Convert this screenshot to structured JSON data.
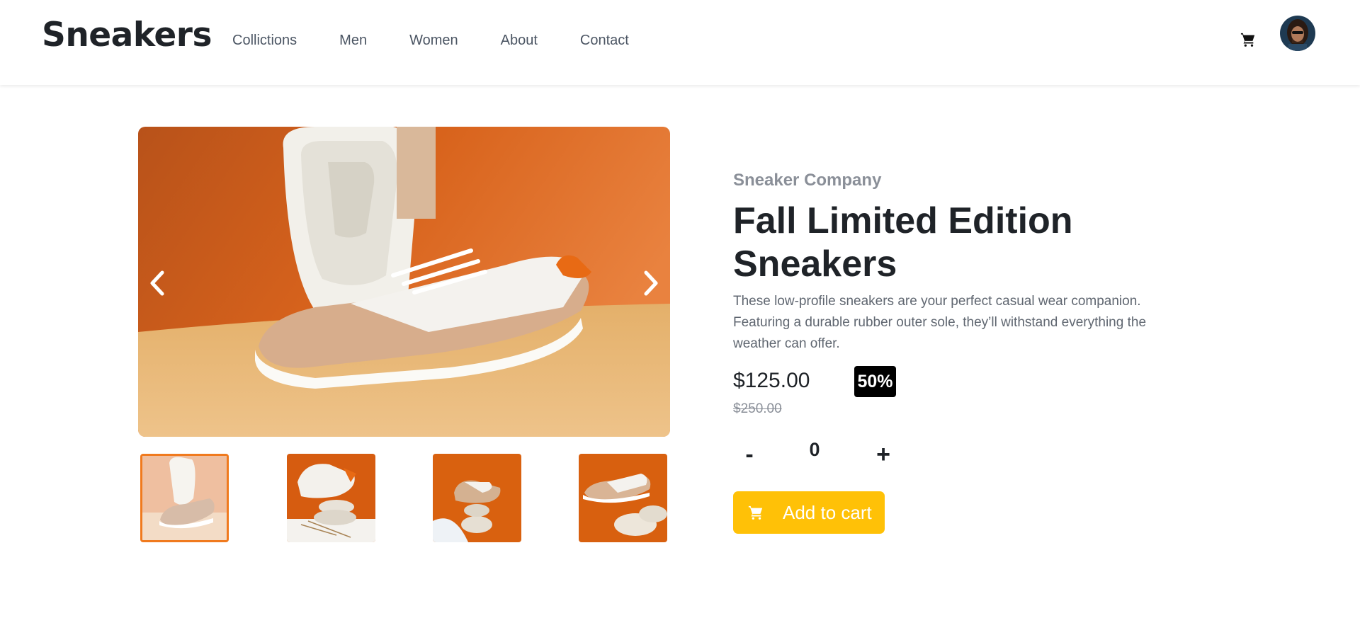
{
  "header": {
    "logo": "Sneakers",
    "nav": [
      "Collictions",
      "Men",
      "Women",
      "About",
      "Contact"
    ],
    "cart_icon": "cart-icon",
    "avatar_icon": "avatar"
  },
  "gallery": {
    "prev_icon": "chevron-left-icon",
    "next_icon": "chevron-right-icon",
    "selected_thumbnail": 1,
    "thumbnail_count": 4
  },
  "product": {
    "company": "Sneaker Company",
    "title": "Fall Limited Edition Sneakers",
    "description": "These low-profile sneakers are your perfect casual wear companion. Featuring a durable rubber outer sole, they’ll withstand everything the weather can offer.",
    "price": "$125.00",
    "discount": "50%",
    "old_price": "$250.00",
    "quantity": "0",
    "minus_label": "-",
    "plus_label": "+",
    "add_to_cart_label": "Add to cart"
  },
  "colors": {
    "accent": "#ffc107",
    "thumb_active_border": "#f07a1e",
    "text_dark": "#1f2328",
    "text_muted": "#8a8f98",
    "discount_bg": "#000000"
  }
}
